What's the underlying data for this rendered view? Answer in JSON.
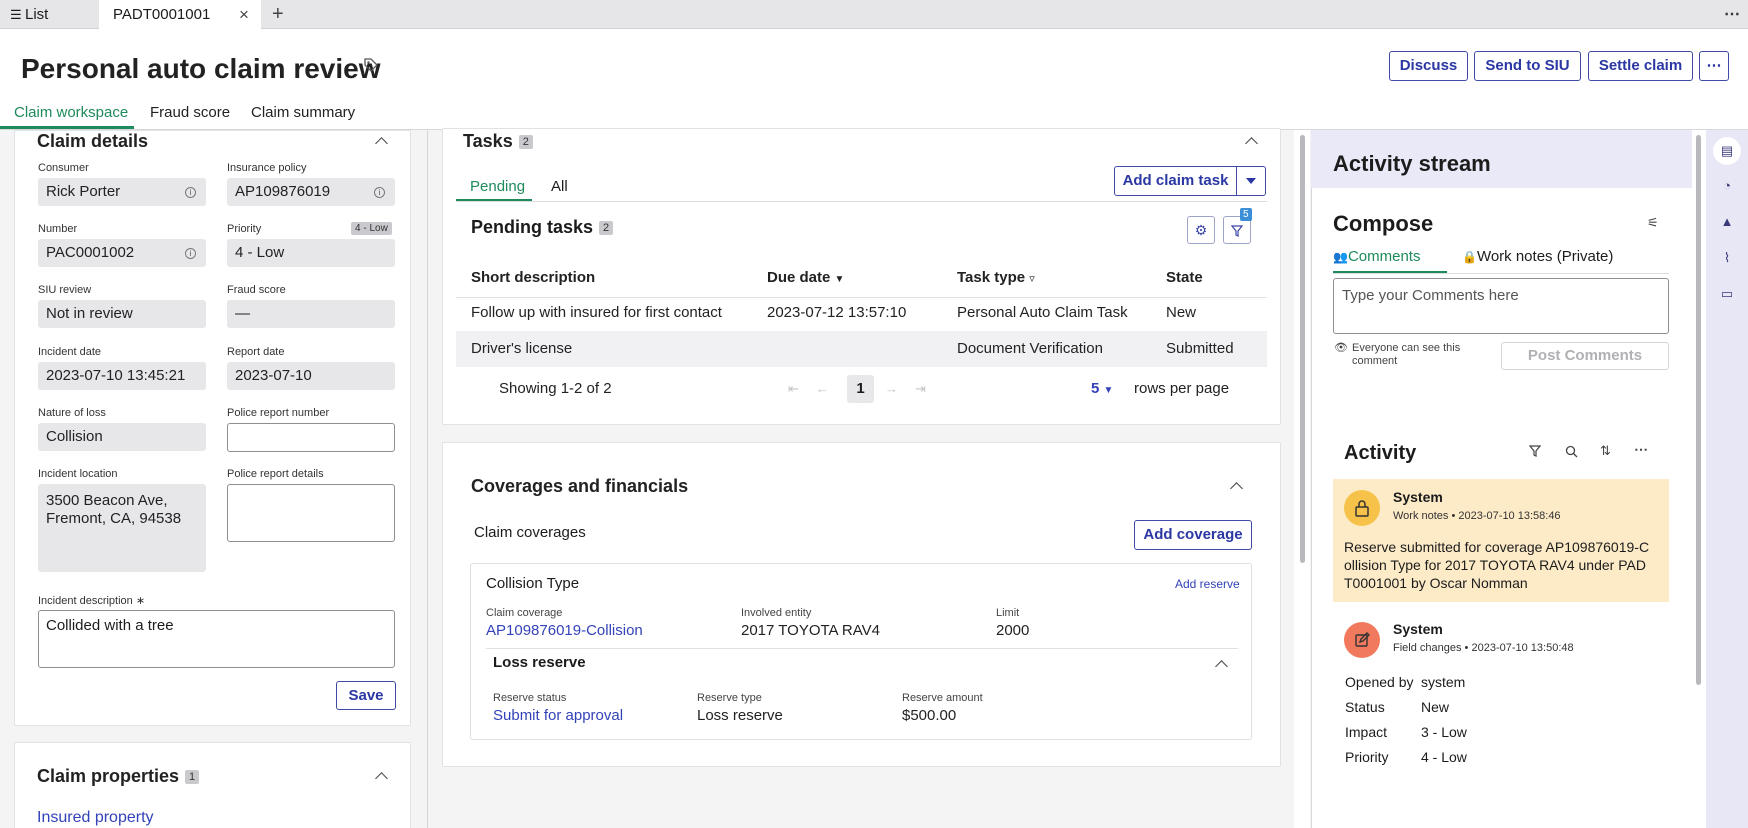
{
  "tabs": {
    "list_label": "List",
    "record_tab": "PADT0001001",
    "close": "×",
    "add": "+",
    "more": "⋯"
  },
  "header": {
    "title": "Personal auto claim review",
    "discuss": "Discuss",
    "send_siu": "Send to SIU",
    "settle": "Settle claim",
    "more": "⋯"
  },
  "page_tabs": {
    "workspace": "Claim workspace",
    "fraud": "Fraud score",
    "summary": "Claim summary"
  },
  "claim_details": {
    "title": "Claim details",
    "consumer": {
      "label": "Consumer",
      "value": "Rick Porter"
    },
    "policy": {
      "label": "Insurance policy",
      "value": "AP109876019"
    },
    "number": {
      "label": "Number",
      "value": "PAC0001002"
    },
    "priority": {
      "label": "Priority",
      "value": "4 - Low",
      "tag": "4 - Low"
    },
    "siu": {
      "label": "SIU review",
      "value": "Not in review"
    },
    "fraud": {
      "label": "Fraud score",
      "value": "—"
    },
    "incident_date": {
      "label": "Incident date",
      "value": "2023-07-10 13:45:21"
    },
    "report_date": {
      "label": "Report date",
      "value": "2023-07-10"
    },
    "nature": {
      "label": "Nature of loss",
      "value": "Collision"
    },
    "police_num": {
      "label": "Police report number",
      "value": ""
    },
    "location": {
      "label": "Incident location",
      "line1": "3500 Beacon Ave,",
      "line2": "Fremont, CA, 94538"
    },
    "police_details": {
      "label": "Police report details",
      "value": ""
    },
    "description": {
      "label": "Incident description",
      "required": "∗",
      "value": "Collided with a tree"
    },
    "save": "Save"
  },
  "claim_properties": {
    "title": "Claim properties",
    "count": "1",
    "insured": "Insured property"
  },
  "tasks": {
    "title": "Tasks",
    "count": "2",
    "tab_pending": "Pending",
    "tab_all": "All",
    "add_task": "Add claim task",
    "pending_title": "Pending tasks",
    "pending_count": "2",
    "filter_count": "5",
    "columns": {
      "desc": "Short description",
      "due": "Due date",
      "type": "Task type",
      "state": "State"
    },
    "rows": [
      {
        "desc": "Follow up with insured for first contact",
        "due": "2023-07-12 13:57:10",
        "type": "Personal Auto Claim Task",
        "state": "New"
      },
      {
        "desc": "Driver's license",
        "due": "",
        "type": "Document Verification",
        "state": "Submitted"
      }
    ],
    "showing": "Showing 1-2 of 2",
    "page": "1",
    "rows_count": "5",
    "rows_per_page": "rows per page"
  },
  "coverages": {
    "title": "Coverages and financials",
    "claim_coverages": "Claim coverages",
    "add_coverage": "Add coverage",
    "type_title": "Collision Type",
    "add_reserve": "Add reserve",
    "coverage_label": "Claim coverage",
    "coverage_value": "AP109876019-Collision",
    "entity_label": "Involved entity",
    "entity_value": "2017 TOYOTA RAV4",
    "limit_label": "Limit",
    "limit_value": "2000",
    "loss_title": "Loss reserve",
    "status_label": "Reserve status",
    "status_value": "Submit for approval",
    "rtype_label": "Reserve type",
    "rtype_value": "Loss reserve",
    "amount_label": "Reserve amount",
    "amount_value": "$500.00"
  },
  "activity": {
    "stream_title": "Activity stream",
    "compose": "Compose",
    "tab_comments": "Comments",
    "tab_worknotes": "Work notes (Private)",
    "placeholder": "Type your Comments here",
    "visibility_line1": "Everyone can see this",
    "visibility_line2": "comment",
    "post": "Post Comments",
    "activity_title": "Activity",
    "entry1": {
      "author": "System",
      "kind": "Work notes",
      "time": "2023-07-10 13:58:46",
      "line1": "Reserve submitted for coverage AP109876019-C",
      "line2": "ollision Type for 2017 TOYOTA RAV4 under PAD",
      "line3": "T0001001 by Oscar Nomman"
    },
    "entry2": {
      "author": "System",
      "kind": "Field changes",
      "time": "2023-07-10 13:50:48",
      "fields": [
        {
          "label": "Opened by",
          "value": "system"
        },
        {
          "label": "Status",
          "value": "New"
        },
        {
          "label": "Impact",
          "value": "3 - Low"
        },
        {
          "label": "Priority",
          "value": "4 - Low"
        }
      ]
    }
  },
  "colors": {
    "accent": "#2b37a3",
    "green_tab": "#1f8a5c",
    "highlight": "#fdebc8",
    "lock_bg": "#f6c24a",
    "edit_bg": "#f0795e"
  }
}
